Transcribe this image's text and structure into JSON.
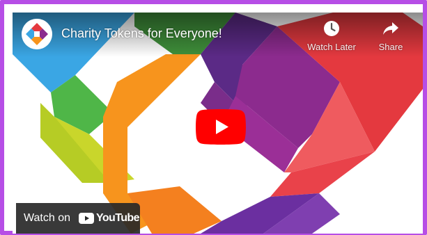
{
  "video": {
    "title": "Charity Tokens for Everyone!",
    "channel_logo_icon": "heart-ribbon-logo-icon"
  },
  "controls": {
    "watch_later_label": "Watch Later",
    "watch_later_icon": "clock-icon",
    "share_label": "Share",
    "share_icon": "share-arrow-icon"
  },
  "play_button": {
    "icon": "play-icon",
    "color": "#ff0000"
  },
  "watch_on": {
    "label": "Watch on",
    "brand": "YouTube",
    "brand_icon": "youtube-play-icon"
  },
  "theme": {
    "frame_border": "#b64ee6",
    "ribbon_colors": [
      "#3aa7e6",
      "#52b848",
      "#c7d62a",
      "#f7941e",
      "#8e2a8f",
      "#e63946",
      "#6b2fa0"
    ]
  }
}
